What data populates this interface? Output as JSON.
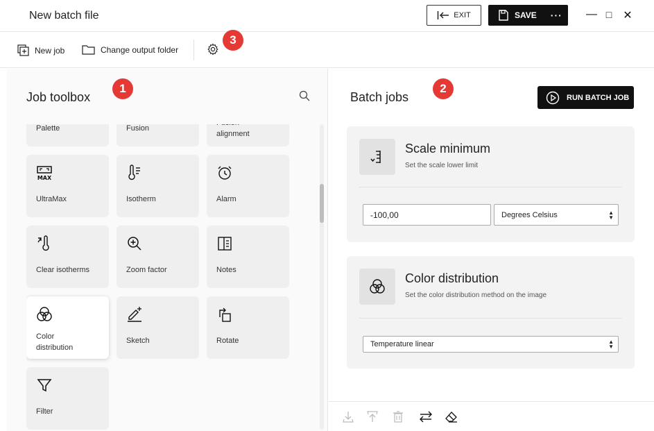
{
  "app": {
    "title": "New batch file"
  },
  "titlebar": {
    "exit_label": "EXIT",
    "save_label": "SAVE",
    "more_label": "···",
    "minimize": "—",
    "maximize": "□",
    "close": "✕"
  },
  "toolbar": {
    "new_job_label": "New job",
    "change_output_label": "Change output folder"
  },
  "badges": {
    "one": "1",
    "two": "2",
    "three": "3"
  },
  "toolbox": {
    "title": "Job toolbox",
    "tools": [
      {
        "label": "Palette",
        "icon": "palette-icon"
      },
      {
        "label": "Fusion",
        "icon": "fusion-icon"
      },
      {
        "label": "Fusion alignment",
        "icon": "fusion-alignment-icon"
      },
      {
        "label": "UltraMax",
        "icon": "ultramax-icon"
      },
      {
        "label": "Isotherm",
        "icon": "isotherm-icon"
      },
      {
        "label": "Alarm",
        "icon": "alarm-icon"
      },
      {
        "label": "Clear isotherms",
        "icon": "clear-isotherms-icon"
      },
      {
        "label": "Zoom factor",
        "icon": "zoom-icon"
      },
      {
        "label": "Notes",
        "icon": "notes-icon"
      },
      {
        "label": "Color distribution",
        "icon": "color-distribution-icon"
      },
      {
        "label": "Sketch",
        "icon": "sketch-icon"
      },
      {
        "label": "Rotate",
        "icon": "rotate-icon"
      },
      {
        "label": "Filter",
        "icon": "filter-icon"
      }
    ]
  },
  "batch": {
    "title": "Batch jobs",
    "run_label": "RUN BATCH JOB",
    "jobs": [
      {
        "title": "Scale minimum",
        "desc": "Set the scale lower limit",
        "value": "-100,00",
        "unit": "Degrees Celsius"
      },
      {
        "title": "Color distribution",
        "desc": "Set the color distribution method on the image",
        "method": "Temperature linear"
      }
    ]
  },
  "colors": {
    "accent_dark": "#111111",
    "badge_red": "#e53935",
    "card_bg": "#efefef"
  }
}
